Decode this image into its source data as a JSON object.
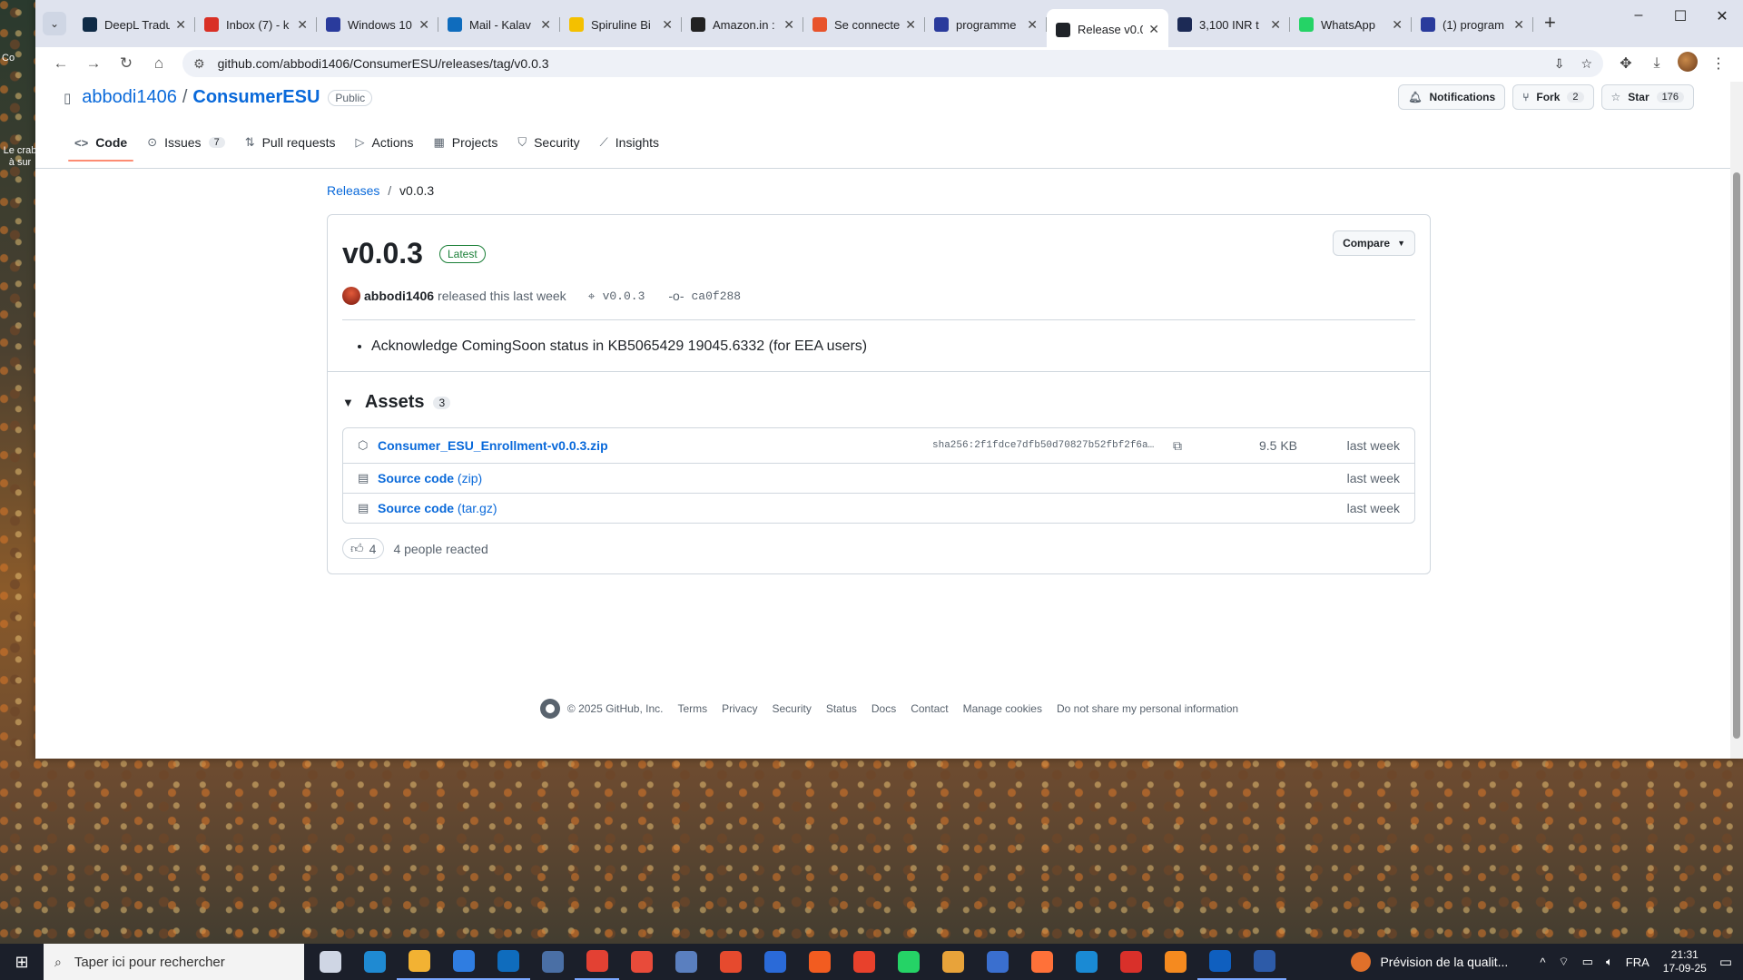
{
  "desktop": {
    "icon1_label": "Co",
    "icon2_label": "Le crab à sur"
  },
  "browser": {
    "tabs": [
      {
        "title": "DeepL Tradu",
        "color": "#0f2b46"
      },
      {
        "title": "Inbox (7) - k",
        "color": "#d93025"
      },
      {
        "title": "Windows 10",
        "color": "#2a3b9c"
      },
      {
        "title": "Mail - Kalav",
        "color": "#0f6cbd"
      },
      {
        "title": "Spiruline Bi",
        "color": "#f4c000"
      },
      {
        "title": "Amazon.in :",
        "color": "#222222"
      },
      {
        "title": "Se connecte",
        "color": "#e8532b"
      },
      {
        "title": "programme",
        "color": "#2a3b9c"
      },
      {
        "title": "Release v0.0",
        "color": "#1f2328"
      },
      {
        "title": "3,100 INR t",
        "color": "#1c2a55"
      },
      {
        "title": "WhatsApp",
        "color": "#25d366"
      },
      {
        "title": "(1) program",
        "color": "#2a3b9c"
      }
    ],
    "active_tab_index": 8,
    "url": "github.com/abbodi1406/ConsumerESU/releases/tag/v0.0.3"
  },
  "repo": {
    "owner": "abbodi1406",
    "name": "ConsumerESU",
    "visibility": "Public",
    "notifications_label": "Notifications",
    "fork_label": "Fork",
    "fork_count": "2",
    "star_label": "Star",
    "star_count": "176",
    "nav": {
      "code": "Code",
      "issues": "Issues",
      "issues_count": "7",
      "pulls": "Pull requests",
      "actions": "Actions",
      "projects": "Projects",
      "security": "Security",
      "insights": "Insights"
    }
  },
  "release": {
    "breadcrumb_root": "Releases",
    "breadcrumb_current": "v0.0.3",
    "title": "v0.0.3",
    "badge": "Latest",
    "compare_label": "Compare",
    "author": "abbodi1406",
    "released_text": "released this last week",
    "tag": "v0.0.3",
    "commit": "ca0f288",
    "notes": [
      "Acknowledge ComingSoon status in KB5065429 19045.6332 (for EEA users)"
    ],
    "assets_label": "Assets",
    "assets_count": "3",
    "assets": [
      {
        "name": "Consumer_ESU_Enrollment-v0.0.3.zip",
        "sha": "sha256:2f1fdce7dfb50d70827b52fbf2f6a…",
        "size": "9.5 KB",
        "when": "last week"
      },
      {
        "name": "Source code",
        "suffix": "(zip)",
        "when": "last week"
      },
      {
        "name": "Source code",
        "suffix": "(tar.gz)",
        "when": "last week"
      }
    ],
    "reaction_count": "4",
    "reaction_text": "4 people reacted"
  },
  "footer": {
    "copyright": "© 2025 GitHub, Inc.",
    "links": [
      "Terms",
      "Privacy",
      "Security",
      "Status",
      "Docs",
      "Contact",
      "Manage cookies",
      "Do not share my personal information"
    ]
  },
  "taskbar": {
    "search_placeholder": "Taper ici pour rechercher",
    "weather": "Prévision de la qualit...",
    "lang": "FRA",
    "time": "21:31",
    "date": "17-09-25",
    "app_colors": [
      "#cfd6e4",
      "#1f8ad2",
      "#f2b233",
      "#2f7de1",
      "#0f6cbd",
      "#4a6fa5",
      "#e34133",
      "#e84b3a",
      "#5a7fbf",
      "#e64a2e",
      "#2a6ad8",
      "#f25c20",
      "#e8412c",
      "#25d366",
      "#e8a33a",
      "#3a6fcf",
      "#ff7139",
      "#1a8ad4",
      "#d9302a",
      "#f58a1f",
      "#0f5fbf",
      "#2d5ba8"
    ]
  }
}
